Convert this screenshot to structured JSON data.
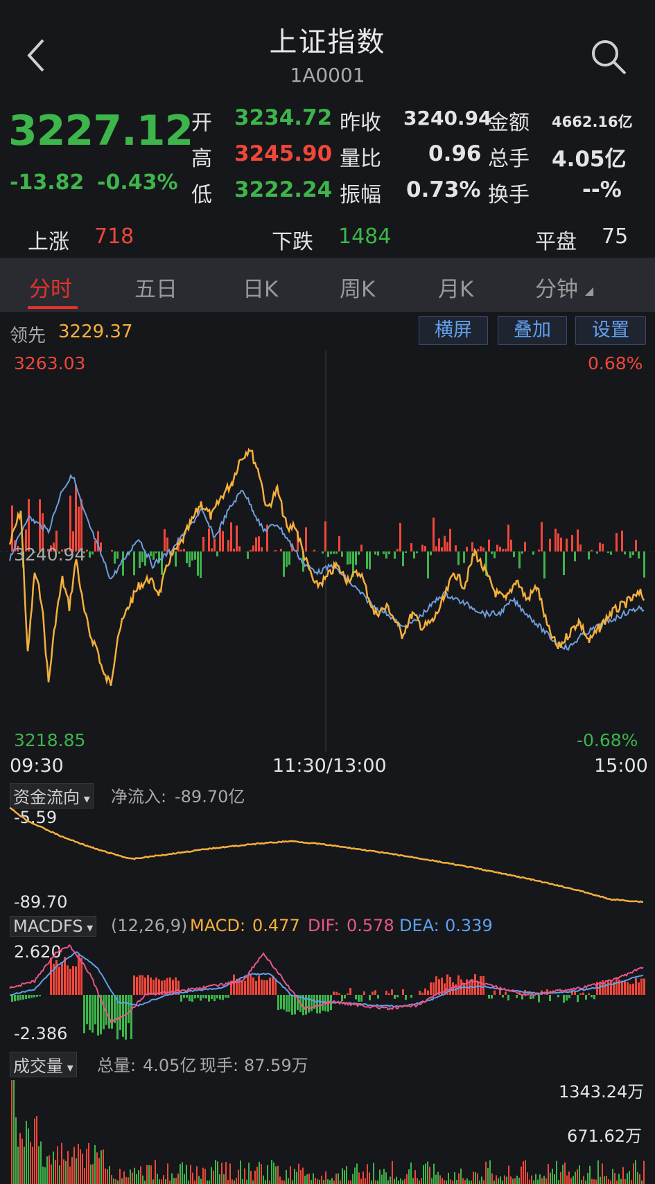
{
  "header": {
    "title": "上证指数",
    "code": "1A0001",
    "back_icon": "chevron-left-icon",
    "search_icon": "search-icon"
  },
  "quote": {
    "price": "3227.12",
    "change": "-13.82",
    "change_pct": "-0.43%",
    "open_label": "开",
    "open": "3234.72",
    "high_label": "高",
    "high": "3245.90",
    "low_label": "低",
    "low": "3222.24",
    "prev_close_label": "昨收",
    "prev_close": "3240.94",
    "volume_ratio_label": "量比",
    "volume_ratio": "0.96",
    "amplitude_label": "振幅",
    "amplitude": "0.73%",
    "amount_label": "金额",
    "amount": "4662.16亿",
    "total_hands_label": "总手",
    "total_hands": "4.05亿",
    "turnover_label": "换手",
    "turnover": "--%"
  },
  "breadth": {
    "up_label": "上涨",
    "up": "718",
    "down_label": "下跌",
    "down": "1484",
    "flat_label": "平盘",
    "flat": "75"
  },
  "tabs": [
    "分时",
    "五日",
    "日K",
    "周K",
    "月K",
    "分钟"
  ],
  "buttons": {
    "landscape": "横屏",
    "overlay": "叠加",
    "settings": "设置"
  },
  "intraday": {
    "lead_label": "领先",
    "lead_value": "3229.37",
    "top_price": "3263.03",
    "top_pct": "0.68%",
    "mid_price": "3240.94",
    "bottom_price": "3218.85",
    "bottom_pct": "-0.68%",
    "time_start": "09:30",
    "time_mid": "11:30/13:00",
    "time_end": "15:00"
  },
  "fund_flow": {
    "selector": "资金流向",
    "net_label": "净流入:",
    "net_value": "-89.70亿",
    "axis_top": "-5.59",
    "axis_bottom": "-89.70"
  },
  "macd": {
    "selector": "MACDFS",
    "params": "(12,26,9)",
    "macd_label": "MACD:",
    "macd_value": "0.477",
    "dif_label": "DIF:",
    "dif_value": "0.578",
    "dea_label": "DEA:",
    "dea_value": "0.339",
    "axis_top": "2.620",
    "axis_bottom": "-2.386"
  },
  "volume": {
    "selector": "成交量",
    "total_label": "总量:",
    "total_value": "4.05亿",
    "current_label": "现手:",
    "current_value": "87.59万",
    "axis_top": "1343.24万",
    "axis_mid": "671.62万"
  },
  "colors": {
    "up": "#f0473a",
    "down": "#3db54a",
    "price_line": "#f6b03c",
    "avg_line": "#6f9fdc",
    "dif": "#e8578a",
    "dea": "#5fa1ee"
  }
}
